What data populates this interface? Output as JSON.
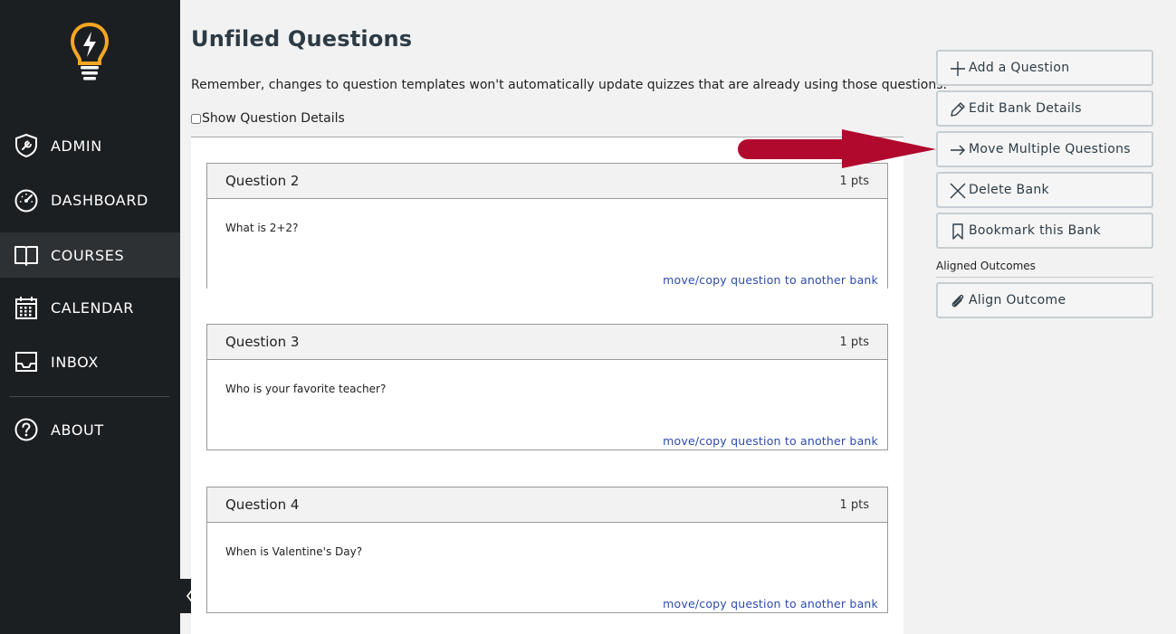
{
  "sidebar": {
    "items": [
      {
        "label": "ADMIN",
        "icon": "admin-shield-icon"
      },
      {
        "label": "DASHBOARD",
        "icon": "dashboard-gauge-icon"
      },
      {
        "label": "COURSES",
        "icon": "book-icon"
      },
      {
        "label": "CALENDAR",
        "icon": "calendar-icon"
      },
      {
        "label": "INBOX",
        "icon": "inbox-icon"
      },
      {
        "label": "ABOUT",
        "icon": "help-circle-icon"
      }
    ],
    "active": "COURSES"
  },
  "main": {
    "title": "Unfiled Questions",
    "notice": "Remember, changes to question templates won't automatically update quizzes that are already using those questions.",
    "show_details_label": "Show Question Details",
    "questions": [
      {
        "name": "Question 2",
        "points": "1 pts",
        "text": "What is 2+2?",
        "link": "move/copy question to another bank"
      },
      {
        "name": "Question 3",
        "points": "1 pts",
        "text": "Who is your favorite teacher?",
        "link": "move/copy question to another bank"
      },
      {
        "name": "Question 4",
        "points": "1 pts",
        "text": "When is Valentine's Day?",
        "link": "move/copy question to another bank"
      }
    ]
  },
  "actions": {
    "add_question": "Add a Question",
    "edit_bank": "Edit Bank Details",
    "move_multiple": "Move Multiple Questions",
    "delete_bank": "Delete Bank",
    "bookmark_bank": "Bookmark this Bank",
    "aligned_outcomes_heading": "Aligned Outcomes",
    "align_outcome": "Align Outcome"
  },
  "colors": {
    "sidebar_bg": "#1c1f22",
    "logo_orange": "#f5a623",
    "link_blue": "#2d4bb0",
    "annotation_arrow": "#b0092d"
  }
}
